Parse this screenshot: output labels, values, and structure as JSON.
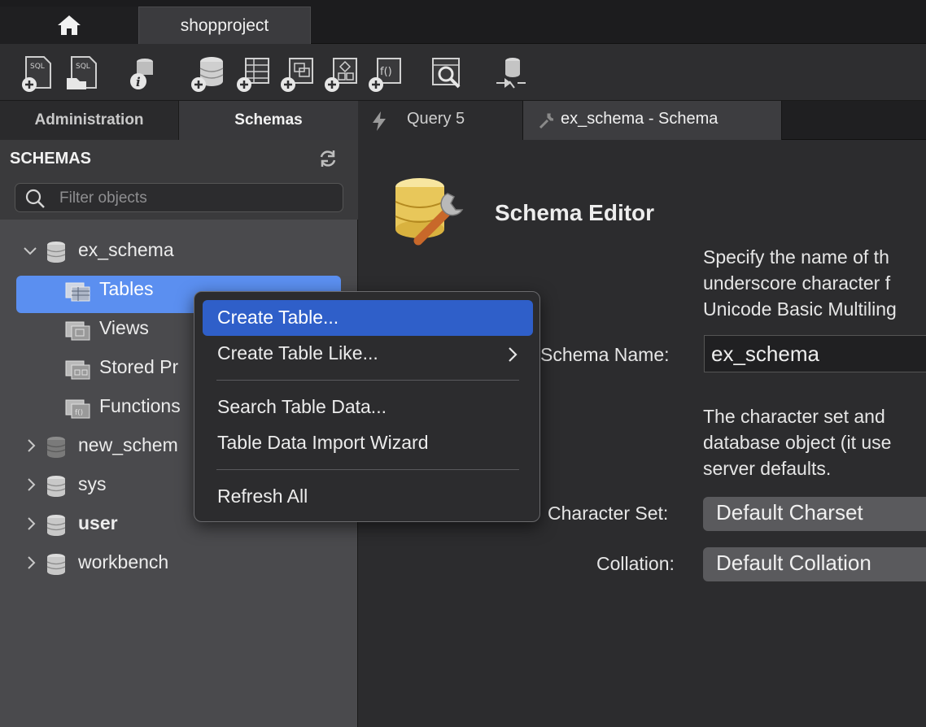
{
  "top_tabs": {
    "project": "shopproject"
  },
  "toolbar": {
    "icons": [
      "new-sql-tab-icon",
      "open-sql-script-icon",
      "inspector-icon",
      "create-schema-icon",
      "create-table-icon",
      "create-view-icon",
      "create-procedure-icon",
      "create-function-icon",
      "search-table-data-icon",
      "reconnect-icon"
    ]
  },
  "left_tabs": {
    "administration": "Administration",
    "schemas": "Schemas"
  },
  "schemas_panel": {
    "title": "SCHEMAS",
    "filter_placeholder": "Filter objects",
    "tree": {
      "ex_schema": "ex_schema",
      "tables": "Tables",
      "views": "Views",
      "stored_procedures": "Stored Pr",
      "functions": "Functions",
      "new_schema": "new_schem",
      "sys": "sys",
      "user": "user",
      "workbench": "workbench"
    }
  },
  "right_tabs": {
    "query": "Query 5",
    "schema": "ex_schema - Schema"
  },
  "editor": {
    "title": "Schema Editor",
    "desc1_line1": "Specify the name of th",
    "desc1_line2": "underscore character f",
    "desc1_line3": "Unicode Basic Multiling",
    "schema_name_label": "Schema Name:",
    "schema_name_value": "ex_schema",
    "desc2_line1": "The character set and",
    "desc2_line2": "database object (it use",
    "desc2_line3": "server defaults.",
    "charset_label": "Character Set:",
    "charset_value": "Default Charset",
    "collation_label": "Collation:",
    "collation_value": "Default Collation"
  },
  "context_menu": {
    "create_table": "Create Table...",
    "create_table_like": "Create Table Like...",
    "search_table_data": "Search Table Data...",
    "import_wizard": "Table Data Import Wizard",
    "refresh_all": "Refresh All"
  },
  "colors": {
    "selection": "#5b8ff0",
    "menu_highlight": "#2f5fc9"
  }
}
